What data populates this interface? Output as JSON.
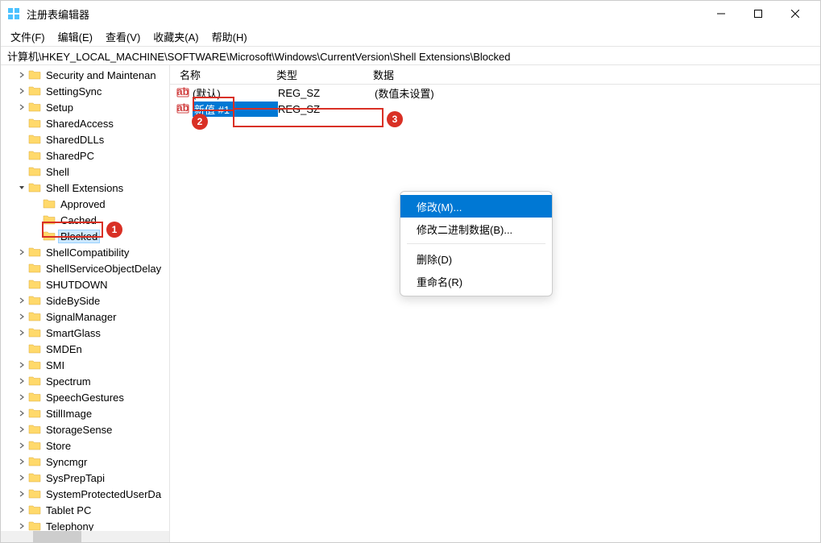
{
  "window": {
    "title": "注册表编辑器"
  },
  "menubar": {
    "file": "文件(F)",
    "edit": "编辑(E)",
    "view": "查看(V)",
    "favorites": "收藏夹(A)",
    "help": "帮助(H)"
  },
  "address": {
    "path": "计算机\\HKEY_LOCAL_MACHINE\\SOFTWARE\\Microsoft\\Windows\\CurrentVersion\\Shell Extensions\\Blocked"
  },
  "tree": [
    {
      "label": "Security and Maintenan",
      "depth": 1,
      "exp": "closed"
    },
    {
      "label": "SettingSync",
      "depth": 1,
      "exp": "closed"
    },
    {
      "label": "Setup",
      "depth": 1,
      "exp": "closed"
    },
    {
      "label": "SharedAccess",
      "depth": 1,
      "exp": "none"
    },
    {
      "label": "SharedDLLs",
      "depth": 1,
      "exp": "none"
    },
    {
      "label": "SharedPC",
      "depth": 1,
      "exp": "none"
    },
    {
      "label": "Shell",
      "depth": 1,
      "exp": "none"
    },
    {
      "label": "Shell Extensions",
      "depth": 1,
      "exp": "open"
    },
    {
      "label": "Approved",
      "depth": 2,
      "exp": "none"
    },
    {
      "label": "Cached",
      "depth": 2,
      "exp": "none"
    },
    {
      "label": "Blocked",
      "depth": 2,
      "exp": "none",
      "selected": true
    },
    {
      "label": "ShellCompatibility",
      "depth": 1,
      "exp": "closed"
    },
    {
      "label": "ShellServiceObjectDelay",
      "depth": 1,
      "exp": "none"
    },
    {
      "label": "SHUTDOWN",
      "depth": 1,
      "exp": "none"
    },
    {
      "label": "SideBySide",
      "depth": 1,
      "exp": "closed"
    },
    {
      "label": "SignalManager",
      "depth": 1,
      "exp": "closed"
    },
    {
      "label": "SmartGlass",
      "depth": 1,
      "exp": "closed"
    },
    {
      "label": "SMDEn",
      "depth": 1,
      "exp": "none"
    },
    {
      "label": "SMI",
      "depth": 1,
      "exp": "closed"
    },
    {
      "label": "Spectrum",
      "depth": 1,
      "exp": "closed"
    },
    {
      "label": "SpeechGestures",
      "depth": 1,
      "exp": "closed"
    },
    {
      "label": "StillImage",
      "depth": 1,
      "exp": "closed"
    },
    {
      "label": "StorageSense",
      "depth": 1,
      "exp": "closed"
    },
    {
      "label": "Store",
      "depth": 1,
      "exp": "closed"
    },
    {
      "label": "Syncmgr",
      "depth": 1,
      "exp": "closed"
    },
    {
      "label": "SysPrepTapi",
      "depth": 1,
      "exp": "closed"
    },
    {
      "label": "SystemProtectedUserDa",
      "depth": 1,
      "exp": "closed"
    },
    {
      "label": "Tablet PC",
      "depth": 1,
      "exp": "closed"
    },
    {
      "label": "Telephony",
      "depth": 1,
      "exp": "closed"
    }
  ],
  "list": {
    "headers": {
      "name": "名称",
      "type": "类型",
      "data": "数据"
    },
    "rows": [
      {
        "name": "(默认)",
        "type": "REG_SZ",
        "data": "(数值未设置)",
        "selected": false
      },
      {
        "name": "新值 #1",
        "type": "REG_SZ",
        "data": "",
        "selected": true
      }
    ]
  },
  "context_menu": {
    "modify": "修改(M)...",
    "modify_binary": "修改二进制数据(B)...",
    "delete": "删除(D)",
    "rename": "重命名(R)"
  },
  "callouts": {
    "c1": "1",
    "c2": "2",
    "c3": "3"
  }
}
